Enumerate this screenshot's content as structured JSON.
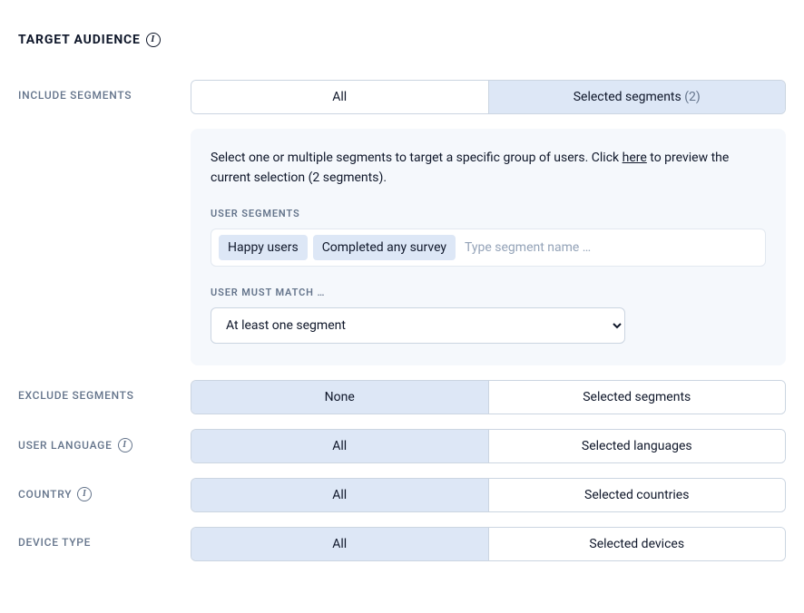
{
  "header": {
    "title": "TARGET AUDIENCE"
  },
  "include_segments": {
    "label": "INCLUDE SEGMENTS",
    "options": {
      "all": "All",
      "selected": "Selected segments",
      "count": "(2)"
    },
    "panel": {
      "desc_before": "Select one or multiple segments to target a specific group of users. Click ",
      "desc_link": "here",
      "desc_after": " to preview the current selection (2 segments).",
      "user_segments_label": "USER SEGMENTS",
      "chips": [
        "Happy users",
        "Completed any survey"
      ],
      "input_placeholder": "Type segment name …",
      "match_label": "USER MUST MATCH …",
      "match_options": [
        "At least one segment"
      ]
    }
  },
  "exclude_segments": {
    "label": "EXCLUDE SEGMENTS",
    "options": {
      "none": "None",
      "selected": "Selected segments"
    }
  },
  "user_language": {
    "label": "USER LANGUAGE",
    "options": {
      "all": "All",
      "selected": "Selected languages"
    }
  },
  "country": {
    "label": "COUNTRY",
    "options": {
      "all": "All",
      "selected": "Selected countries"
    }
  },
  "device_type": {
    "label": "DEVICE TYPE",
    "options": {
      "all": "All",
      "selected": "Selected devices"
    }
  }
}
